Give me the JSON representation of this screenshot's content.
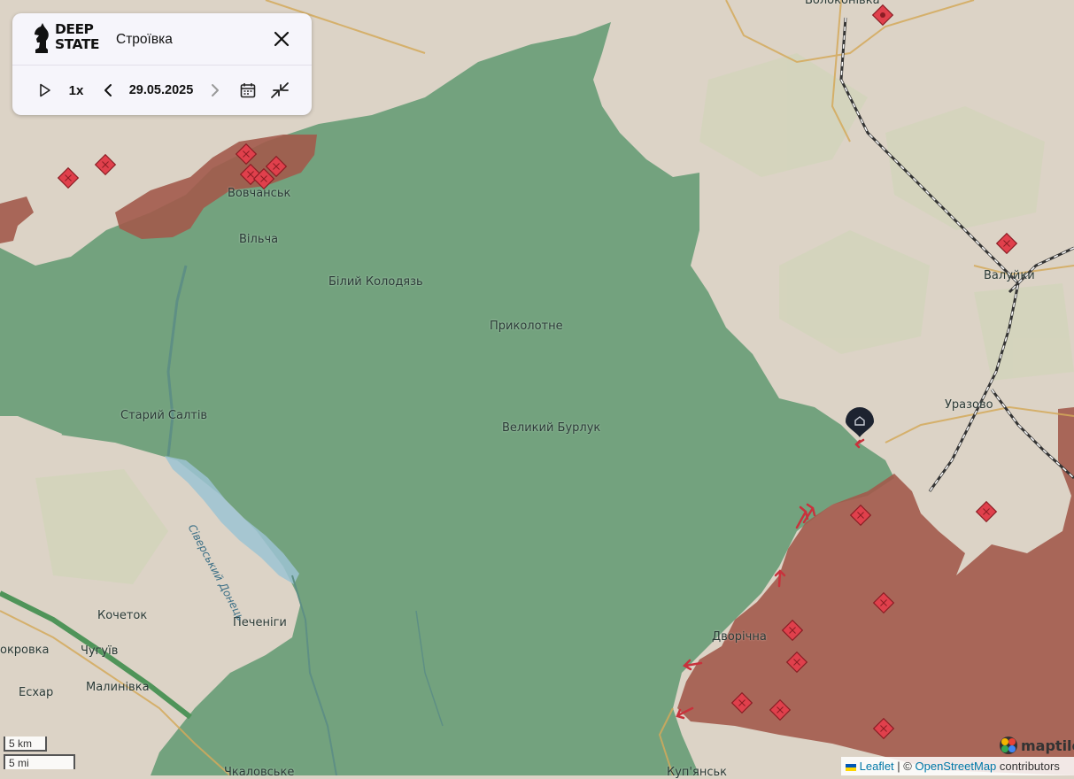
{
  "header": {
    "logo_text_line1": "DEEP",
    "logo_text_line2": "STATE",
    "area_name": "Строївка"
  },
  "timeline": {
    "speed": "1x",
    "date": "29.05.2025"
  },
  "places": [
    {
      "name": "Вовчанськ",
      "key": "vovchansk"
    },
    {
      "name": "Вільча",
      "key": "vilcha"
    },
    {
      "name": "Білий Колодязь",
      "key": "bilyi-kolodiaz"
    },
    {
      "name": "Приколотне",
      "key": "prykolotne"
    },
    {
      "name": "Старий Салтів",
      "key": "staryi-saltiv"
    },
    {
      "name": "Великий Бурлук",
      "key": "velykyi-burluk"
    },
    {
      "name": "Кочеток",
      "key": "kochetok"
    },
    {
      "name": "Печеніги",
      "key": "pechenihy"
    },
    {
      "name": "Чугуїв",
      "key": "chuhuiv"
    },
    {
      "name": "окровка",
      "key": "pokrovka"
    },
    {
      "name": "Малинівка",
      "key": "malynivka"
    },
    {
      "name": "Есхар",
      "key": "eskhar"
    },
    {
      "name": "Дворічна",
      "key": "dvorichna"
    },
    {
      "name": "Валуйки",
      "key": "valuiky"
    },
    {
      "name": "Уразово",
      "key": "urazovo"
    },
    {
      "name": "Волоконівка",
      "key": "volokonivka"
    },
    {
      "name": "Чкаловське",
      "key": "chkalovske"
    },
    {
      "name": "Куп'янськ",
      "key": "kupiansk"
    }
  ],
  "river_label": "Сіверський Донець",
  "scale": {
    "km": "5 km",
    "mi": "5 mi"
  },
  "attribution": {
    "leaflet": "Leaflet",
    "separator": "| ©",
    "osm": "OpenStreetMap",
    "contributors": "contributors",
    "maptiler": "maptiler"
  },
  "colors": {
    "ukraine_controlled": "#6b9e78",
    "occupied": "#a25a4b",
    "base_land": "#dcd3c6",
    "river": "#9cc3d2",
    "marker": "#e0404c"
  }
}
